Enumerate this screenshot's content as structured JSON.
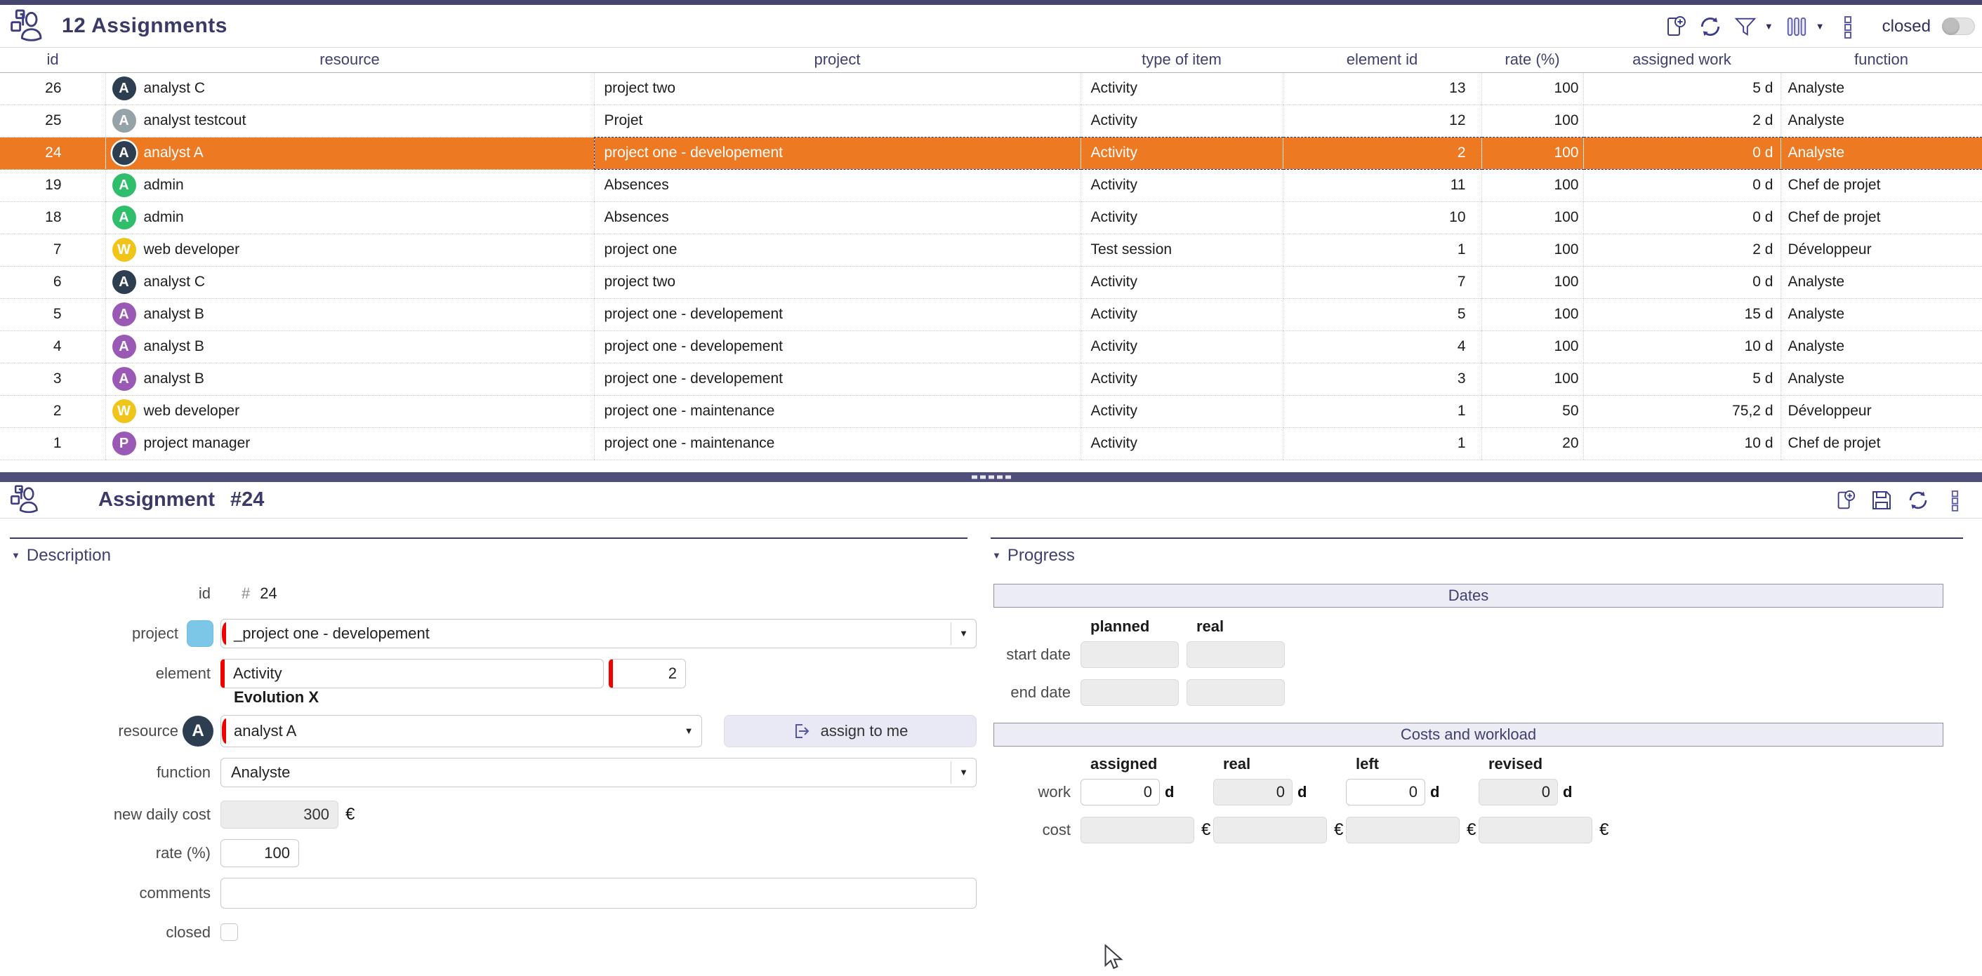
{
  "colors": {
    "accent": "#45456e",
    "selected_row": "#ED7A23",
    "project_swatch": "#7cc6e8",
    "required_mark": "#f20000"
  },
  "icons": {
    "list_header": "assignments-icon",
    "list_toolbar": [
      "add-document-icon",
      "refresh-icon",
      "filter-icon",
      "columns-icon",
      "more-icon"
    ],
    "detail_toolbar": [
      "add-document-icon",
      "save-icon",
      "refresh-icon",
      "more-icon"
    ]
  },
  "list_panel": {
    "title": "12 Assignments",
    "toolbar": {
      "closed_label": "closed"
    },
    "columns": [
      "id",
      "resource",
      "project",
      "type of item",
      "element id",
      "rate (%)",
      "assigned work",
      "function"
    ],
    "rows": [
      {
        "id": "26",
        "resource": "analyst C",
        "avatar_letter": "A",
        "avatar_color": "#2c3e50",
        "project": "project two",
        "type": "Activity",
        "element_id": "13",
        "rate": "100",
        "assigned_work": "5 d",
        "function": "Analyste",
        "selected": false
      },
      {
        "id": "25",
        "resource": "analyst testcout",
        "avatar_letter": "A",
        "avatar_color": "#95a2a8",
        "project": "Projet",
        "type": "Activity",
        "element_id": "12",
        "rate": "100",
        "assigned_work": "2 d",
        "function": "Analyste",
        "selected": false
      },
      {
        "id": "24",
        "resource": "analyst A",
        "avatar_letter": "A",
        "avatar_color": "#2c3e50",
        "project": "project one - developement",
        "type": "Activity",
        "element_id": "2",
        "rate": "100",
        "assigned_work": "0 d",
        "function": "Analyste",
        "selected": true
      },
      {
        "id": "19",
        "resource": "admin",
        "avatar_letter": "A",
        "avatar_color": "#2fbe6b",
        "project": "Absences",
        "type": "Activity",
        "element_id": "11",
        "rate": "100",
        "assigned_work": "0 d",
        "function": "Chef de projet",
        "selected": false
      },
      {
        "id": "18",
        "resource": "admin",
        "avatar_letter": "A",
        "avatar_color": "#2fbe6b",
        "project": "Absences",
        "type": "Activity",
        "element_id": "10",
        "rate": "100",
        "assigned_work": "0 d",
        "function": "Chef de projet",
        "selected": false
      },
      {
        "id": "7",
        "resource": "web developer",
        "avatar_letter": "W",
        "avatar_color": "#f0c419",
        "project": "project one",
        "type": "Test session",
        "element_id": "1",
        "rate": "100",
        "assigned_work": "2 d",
        "function": "Développeur",
        "selected": false
      },
      {
        "id": "6",
        "resource": "analyst C",
        "avatar_letter": "A",
        "avatar_color": "#2c3e50",
        "project": "project two",
        "type": "Activity",
        "element_id": "7",
        "rate": "100",
        "assigned_work": "0 d",
        "function": "Analyste",
        "selected": false
      },
      {
        "id": "5",
        "resource": "analyst B",
        "avatar_letter": "A",
        "avatar_color": "#9b59b6",
        "project": "project one - developement",
        "type": "Activity",
        "element_id": "5",
        "rate": "100",
        "assigned_work": "15 d",
        "function": "Analyste",
        "selected": false
      },
      {
        "id": "4",
        "resource": "analyst B",
        "avatar_letter": "A",
        "avatar_color": "#9b59b6",
        "project": "project one - developement",
        "type": "Activity",
        "element_id": "4",
        "rate": "100",
        "assigned_work": "10 d",
        "function": "Analyste",
        "selected": false
      },
      {
        "id": "3",
        "resource": "analyst B",
        "avatar_letter": "A",
        "avatar_color": "#9b59b6",
        "project": "project one - developement",
        "type": "Activity",
        "element_id": "3",
        "rate": "100",
        "assigned_work": "5 d",
        "function": "Analyste",
        "selected": false
      },
      {
        "id": "2",
        "resource": "web developer",
        "avatar_letter": "W",
        "avatar_color": "#f0c419",
        "project": "project one - maintenance",
        "type": "Activity",
        "element_id": "1",
        "rate": "50",
        "assigned_work": "75,2 d",
        "function": "Développeur",
        "selected": false
      },
      {
        "id": "1",
        "resource": "project manager",
        "avatar_letter": "P",
        "avatar_color": "#9b59b6",
        "project": "project one - maintenance",
        "type": "Activity",
        "element_id": "1",
        "rate": "20",
        "assigned_work": "10 d",
        "function": "Chef de projet",
        "selected": false
      }
    ]
  },
  "detail_panel": {
    "title_label": "Assignment",
    "title_id": "#24",
    "description": {
      "heading": "Description",
      "id_label": "id",
      "id_hash": "#",
      "id_value": "24",
      "project_label": "project",
      "project_value": "_project one - developement",
      "element_label": "element",
      "element_type_value": "Activity",
      "element_id_value": "2",
      "element_name": "Evolution X",
      "resource_label": "resource",
      "resource_avatar_letter": "A",
      "resource_value": "analyst A",
      "assign_to_me_label": "assign to me",
      "function_label": "function",
      "function_value": "Analyste",
      "new_daily_cost_label": "new daily cost",
      "new_daily_cost_value": "300",
      "currency": "€",
      "rate_label": "rate (%)",
      "rate_value": "100",
      "comments_label": "comments",
      "comments_value": "",
      "closed_label": "closed"
    },
    "progress": {
      "heading": "Progress",
      "dates_title": "Dates",
      "date_cols": [
        "planned",
        "real"
      ],
      "start_date_label": "start date",
      "end_date_label": "end date",
      "costs_title": "Costs and workload",
      "cost_cols": [
        "assigned",
        "real",
        "left",
        "revised"
      ],
      "work_label": "work",
      "work_values": [
        "0",
        "0",
        "0",
        "0"
      ],
      "day_suffix": "d",
      "cost_label": "cost",
      "euro_suffix": "€"
    }
  }
}
